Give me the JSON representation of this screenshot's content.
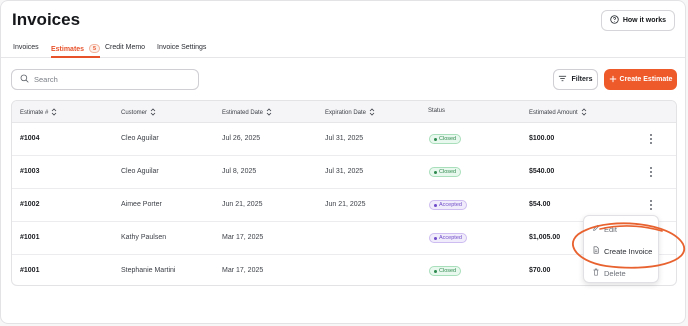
{
  "page": {
    "title": "Invoices"
  },
  "header": {
    "how_it_works_label": "How it works"
  },
  "tabs": [
    {
      "label": "Invoices",
      "active": false
    },
    {
      "label": "Estimates",
      "active": true,
      "badge": "5"
    },
    {
      "label": "Credit Memo",
      "active": false
    },
    {
      "label": "Invoice Settings",
      "active": false
    }
  ],
  "toolbar": {
    "search_placeholder": "Search",
    "filters_label": "Filters",
    "create_label": "Create Estimate"
  },
  "table": {
    "columns": [
      "Estimate #",
      "Customer",
      "Estimated Date",
      "Expiration Date",
      "Status",
      "Estimated Amount"
    ],
    "rows": [
      {
        "id": "#1004",
        "customer": "Cleo Aguilar",
        "est_date": "Jul 26, 2025",
        "exp_date": "Jul 31, 2025",
        "status": "Closed",
        "amount": "$100.00"
      },
      {
        "id": "#1003",
        "customer": "Cleo Aguilar",
        "est_date": "Jul 8, 2025",
        "exp_date": "Jul 31, 2025",
        "status": "Closed",
        "amount": "$540.00"
      },
      {
        "id": "#1002",
        "customer": "Aimee Porter",
        "est_date": "Jun 21, 2025",
        "exp_date": "Jun 21, 2025",
        "status": "Accepted",
        "amount": "$54.00"
      },
      {
        "id": "#1001",
        "customer": "Kathy Paulsen",
        "est_date": "Mar 17, 2025",
        "exp_date": "",
        "status": "Accepted",
        "amount": "$1,005.00"
      },
      {
        "id": "#1001",
        "customer": "Stephanie Martini",
        "est_date": "Mar 17, 2025",
        "exp_date": "",
        "status": "Closed",
        "amount": "$70.00"
      }
    ]
  },
  "row_menu": {
    "edit_label": "Edit",
    "create_invoice_label": "Create Invoice",
    "delete_label": "Delete"
  },
  "colors": {
    "accent": "#ee5a2a",
    "annotation": "#e8622f",
    "closed": "#2f8a4f",
    "accepted": "#6f4cc9"
  },
  "icons": {
    "how_it_works": "help-circle-icon",
    "search": "search-icon",
    "filters": "filter-lines-icon",
    "create": "plus-icon",
    "sort": "sort-arrows-icon",
    "row_actions": "kebab-icon",
    "edit": "pencil-icon",
    "create_invoice": "document-icon",
    "delete": "trash-icon"
  }
}
